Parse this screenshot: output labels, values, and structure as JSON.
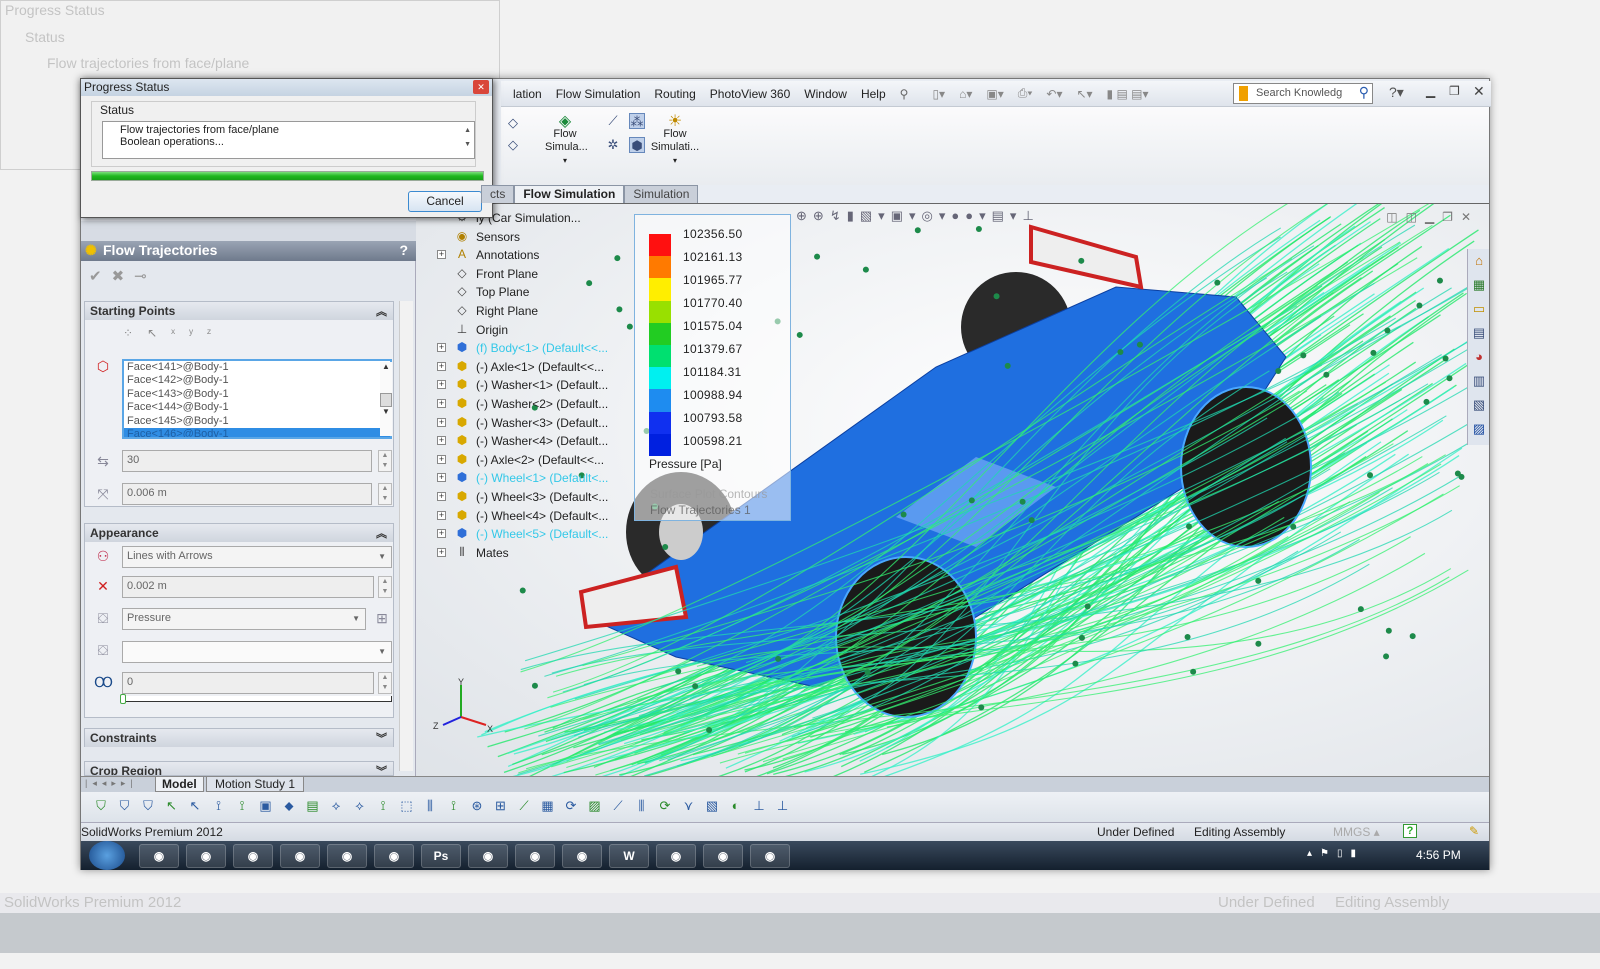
{
  "app": {
    "name": "SolidWorks Premium 2012"
  },
  "menu": {
    "items": [
      "lation",
      "Flow Simulation",
      "Routing",
      "PhotoView 360",
      "Window",
      "Help"
    ]
  },
  "search": {
    "placeholder": "Search Knowledg"
  },
  "command_manager": {
    "buttons": [
      {
        "label": "Flow Simula...",
        "icon": "flow-simulation-icon"
      },
      {
        "label": "Flow Simulati...",
        "icon": "flow-simulation-tools-icon"
      }
    ]
  },
  "tabs": [
    {
      "label": "cts",
      "active": false
    },
    {
      "label": "Flow Simulation",
      "active": true
    },
    {
      "label": "Simulation",
      "active": false
    }
  ],
  "progress_dialog": {
    "title": "Progress Status",
    "group_label": "Status",
    "lines": [
      "Flow trajectories from face/plane",
      "Boolean operations..."
    ],
    "progress": 1.0,
    "cancel_label": "Cancel"
  },
  "property_manager": {
    "title": "Flow Trajectories",
    "help": "?",
    "starting_points": {
      "header": "Starting Points",
      "faces": [
        "Face<141>@Body-1",
        "Face<142>@Body-1",
        "Face<143>@Body-1",
        "Face<144>@Body-1",
        "Face<145>@Body-1",
        "Face<146>@Body-1"
      ],
      "selected_face": 5,
      "number_of_points": "30",
      "offset": "0.006 m"
    },
    "appearance": {
      "header": "Appearance",
      "draw_as": "Lines with Arrows",
      "width": "0.002 m",
      "color_by": "Pressure",
      "secondary": "",
      "transparency": "0",
      "transparency_slider": 0
    },
    "constraints": {
      "header": "Constraints"
    },
    "crop_region": {
      "header": "Crop Region"
    }
  },
  "feature_tree": {
    "items": [
      {
        "label": "ly  (Car Simulation...",
        "icon": "assembly-icon",
        "expand": false,
        "highlight": false
      },
      {
        "label": "Sensors",
        "icon": "sensor-folder-icon",
        "expand": false,
        "highlight": false
      },
      {
        "label": "Annotations",
        "icon": "annotations-icon",
        "expand": true,
        "highlight": false
      },
      {
        "label": "Front Plane",
        "icon": "plane-icon",
        "expand": false,
        "highlight": false
      },
      {
        "label": "Top Plane",
        "icon": "plane-icon",
        "expand": false,
        "highlight": false
      },
      {
        "label": "Right Plane",
        "icon": "plane-icon",
        "expand": false,
        "highlight": false
      },
      {
        "label": "Origin",
        "icon": "origin-icon",
        "expand": false,
        "highlight": false
      },
      {
        "label": "(f) Body<1> (Default<<...",
        "icon": "part-icon",
        "expand": true,
        "highlight": true
      },
      {
        "label": "(-) Axle<1> (Default<<...",
        "icon": "part-icon",
        "expand": true,
        "highlight": false
      },
      {
        "label": "(-) Washer<1> (Default...",
        "icon": "part-icon",
        "expand": true,
        "highlight": false
      },
      {
        "label": "(-) Washer<2> (Default...",
        "icon": "part-icon",
        "expand": true,
        "highlight": false
      },
      {
        "label": "(-) Washer<3> (Default...",
        "icon": "part-icon",
        "expand": true,
        "highlight": false
      },
      {
        "label": "(-) Washer<4> (Default...",
        "icon": "part-icon",
        "expand": true,
        "highlight": false
      },
      {
        "label": "(-) Axle<2> (Default<<...",
        "icon": "part-icon",
        "expand": true,
        "highlight": false
      },
      {
        "label": "(-) Wheel<1> (Default<...",
        "icon": "part-icon",
        "expand": true,
        "highlight": true
      },
      {
        "label": "(-) Wheel<3> (Default<...",
        "icon": "part-icon",
        "expand": true,
        "highlight": false
      },
      {
        "label": "(-) Wheel<4> (Default<...",
        "icon": "part-icon",
        "expand": true,
        "highlight": false
      },
      {
        "label": "(-) Wheel<5> (Default<...",
        "icon": "part-icon",
        "expand": true,
        "highlight": true
      },
      {
        "label": "Mates",
        "icon": "mates-icon",
        "expand": true,
        "highlight": false
      }
    ]
  },
  "legend": {
    "values": [
      "102356.50",
      "102161.13",
      "101965.77",
      "101770.40",
      "101575.04",
      "101379.67",
      "101184.31",
      "100988.94",
      "100793.58",
      "100598.21"
    ],
    "colors": [
      "#ff1010",
      "#ff7a00",
      "#ffee00",
      "#99e000",
      "#22cc22",
      "#00e070",
      "#00f0f0",
      "#1e8cf0",
      "#1030f0",
      "#0020e0"
    ],
    "title": "Pressure [Pa]",
    "overlay_lines": [
      "Surface Plot Contours",
      "Flow Trajectories 1"
    ]
  },
  "bottom_tabs": [
    "Model",
    "Motion Study 1"
  ],
  "status_bar": {
    "left": "SolidWorks Premium 2012",
    "state": "Under Defined",
    "mode": "Editing Assembly",
    "units": "MMGS"
  },
  "taskbar": {
    "time": "4:56 PM",
    "apps": [
      "chrome",
      "media",
      "explorer",
      "acrobat",
      "firefox",
      "app",
      "Ps",
      "app",
      "app",
      "solidworks",
      "W",
      "folder",
      "pdf",
      "app"
    ]
  },
  "colors": {
    "accent": "#2f8de4",
    "progress": "#22c322",
    "model_blue": "#1f6fe0",
    "streamline": "#22ee88"
  }
}
